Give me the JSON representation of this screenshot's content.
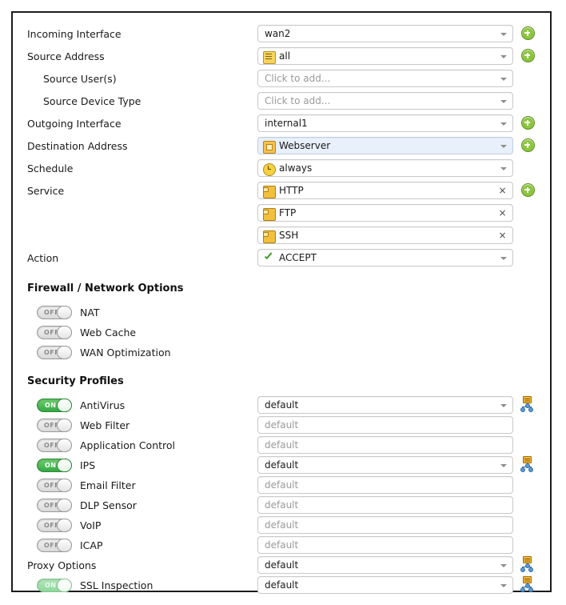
{
  "policy": {
    "rows": [
      {
        "label": "Incoming Interface",
        "indent": "none",
        "value": "wan2",
        "icon": "none",
        "control": "dropdown",
        "add": true,
        "highlight": false
      },
      {
        "label": "Source Address",
        "indent": "none",
        "value": "all",
        "icon": "address-icon",
        "control": "dropdown",
        "add": true,
        "highlight": false
      },
      {
        "label": "Source User(s)",
        "indent": "sub",
        "value": "Click to add...",
        "icon": "none",
        "control": "dropdown",
        "add": false,
        "highlight": false,
        "placeholder": true
      },
      {
        "label": "Source Device Type",
        "indent": "sub",
        "value": "Click to add...",
        "icon": "none",
        "control": "dropdown",
        "add": false,
        "highlight": false,
        "placeholder": true
      },
      {
        "label": "Outgoing Interface",
        "indent": "none",
        "value": "internal1",
        "icon": "none",
        "control": "dropdown",
        "add": true,
        "highlight": false
      },
      {
        "label": "Destination Address",
        "indent": "none",
        "value": "Webserver",
        "icon": "group-icon",
        "control": "dropdown",
        "add": true,
        "highlight": true
      },
      {
        "label": "Schedule",
        "indent": "none",
        "value": "always",
        "icon": "clock-icon",
        "control": "dropdown",
        "add": false,
        "highlight": false
      },
      {
        "label": "Service",
        "indent": "none",
        "value": "HTTP",
        "icon": "service-icon",
        "control": "remove",
        "add": true,
        "highlight": false
      },
      {
        "label": "",
        "indent": "none",
        "value": "FTP",
        "icon": "service-icon",
        "control": "remove",
        "add": false,
        "highlight": false
      },
      {
        "label": "",
        "indent": "none",
        "value": "SSH",
        "icon": "service-icon",
        "control": "remove",
        "add": false,
        "highlight": false
      },
      {
        "label": "Action",
        "indent": "none",
        "value": "ACCEPT",
        "icon": "check-icon",
        "control": "dropdown",
        "add": false,
        "highlight": false
      }
    ]
  },
  "firewall_options": {
    "heading": "Firewall / Network Options",
    "items": [
      {
        "label": "NAT",
        "state": "OFF",
        "state_label": "OFF"
      },
      {
        "label": "Web Cache",
        "state": "OFF",
        "state_label": "OFF"
      },
      {
        "label": "WAN Optimization",
        "state": "OFF",
        "state_label": "OFF"
      }
    ]
  },
  "security_profiles": {
    "heading": "Security Profiles",
    "items": [
      {
        "label": "AntiVirus",
        "toggle": true,
        "state": "ON",
        "state_label": "ON",
        "muted": false,
        "value": "default",
        "enabled": true,
        "profile_icon": true
      },
      {
        "label": "Web Filter",
        "toggle": true,
        "state": "OFF",
        "state_label": "OFF",
        "muted": false,
        "value": "default",
        "enabled": false,
        "profile_icon": false
      },
      {
        "label": "Application Control",
        "toggle": true,
        "state": "OFF",
        "state_label": "OFF",
        "muted": false,
        "value": "default",
        "enabled": false,
        "profile_icon": false
      },
      {
        "label": "IPS",
        "toggle": true,
        "state": "ON",
        "state_label": "ON",
        "muted": false,
        "value": "default",
        "enabled": true,
        "profile_icon": true
      },
      {
        "label": "Email Filter",
        "toggle": true,
        "state": "OFF",
        "state_label": "OFF",
        "muted": false,
        "value": "default",
        "enabled": false,
        "profile_icon": false
      },
      {
        "label": "DLP Sensor",
        "toggle": true,
        "state": "OFF",
        "state_label": "OFF",
        "muted": false,
        "value": "default",
        "enabled": false,
        "profile_icon": false
      },
      {
        "label": "VoIP",
        "toggle": true,
        "state": "OFF",
        "state_label": "OFF",
        "muted": false,
        "value": "default",
        "enabled": false,
        "profile_icon": false
      },
      {
        "label": "ICAP",
        "toggle": true,
        "state": "OFF",
        "state_label": "OFF",
        "muted": false,
        "value": "default",
        "enabled": false,
        "profile_icon": false
      },
      {
        "label": "Proxy Options",
        "toggle": false,
        "state": "",
        "state_label": "",
        "muted": false,
        "value": "default",
        "enabled": true,
        "profile_icon": true
      },
      {
        "label": "SSL Inspection",
        "toggle": true,
        "state": "ON",
        "state_label": "ON",
        "muted": true,
        "value": "default",
        "enabled": true,
        "profile_icon": true
      }
    ]
  }
}
